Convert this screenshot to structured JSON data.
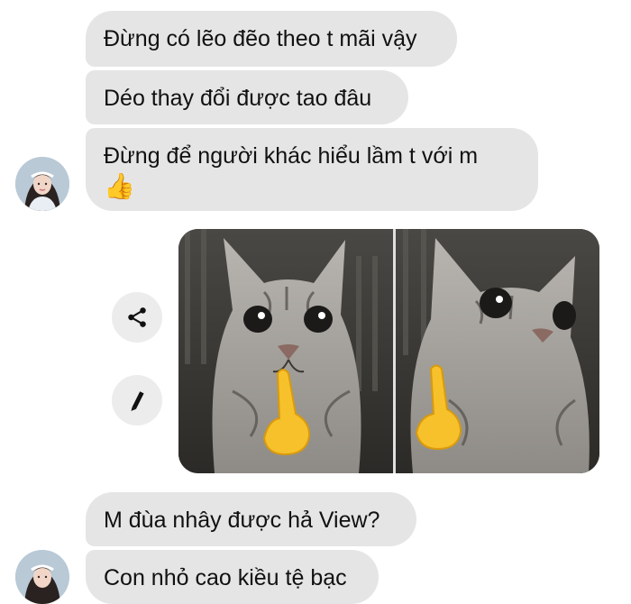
{
  "messages": [
    {
      "text": "Đừng có lẽo đẽo theo t mãi vậy"
    },
    {
      "text": "Déo thay đổi được tao đâu"
    },
    {
      "text": "Đừng để người khác hiểu lầm t với m",
      "emoji": "👍"
    },
    {
      "text": "M đùa nhây được hả View?"
    },
    {
      "text": "Con nhỏ cao kiều tệ bạc"
    }
  ],
  "photo_message": {
    "description_icon": "cat-finger-meme-image",
    "actions": [
      {
        "icon": "share-icon"
      },
      {
        "icon": "pencil-icon"
      }
    ]
  },
  "colors": {
    "bubble": "#e5e5e5",
    "text": "#111111",
    "background": "#ffffff",
    "action_button": "#ececec"
  }
}
